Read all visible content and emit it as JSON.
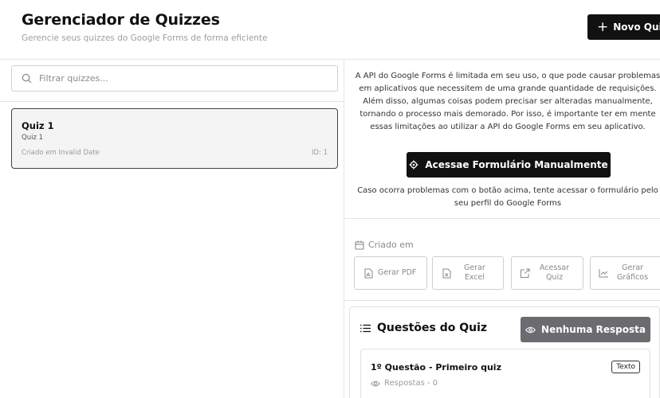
{
  "header": {
    "title": "Gerenciador de Quizzes",
    "subtitle": "Gerencie seus quizzes do Google Forms de forma eficiente",
    "new_button_label": "Novo Quiz"
  },
  "sidebar": {
    "filter_placeholder": "Filtrar quizzes...",
    "quizzes": [
      {
        "title": "Quiz 1",
        "subtitle": "Quiz 1",
        "created": "Criado em Invalid Date",
        "id": "ID: 1"
      }
    ]
  },
  "main": {
    "api_notice": "A API do Google Forms é limitada em seu uso, o que pode causar problemas em aplicativos que necessitem de uma grande quantidade de requisições. Além disso, algumas coisas podem precisar ser alteradas manualmente, tornando o processo mais demorado. Por isso, é importante ter em mente essas limitações ao utilizar a API do Google Forms em seu aplicativo.",
    "access_form_button": "Acessae Formulário Manualmente",
    "problem_notice": "Caso ocorra problemas com o botão acima, tente acessar o formulário pelo seu perfil do Google Forms",
    "created_label": "Criado em",
    "actions": {
      "pdf": "Gerar PDF",
      "excel_1": "Gerar",
      "excel_2": "Excel",
      "quiz_1": "Acessar",
      "quiz_2": "Quiz",
      "charts_1": "Gerar",
      "charts_2": "Gráficos"
    },
    "questions": {
      "title": "Questões do Quiz",
      "no_answer_button": "Nenhuma Resposta",
      "items": [
        {
          "name": "1º Questão - Primeiro quiz",
          "type": "Texto",
          "responses": "Respostas - 0"
        }
      ]
    }
  },
  "colors": {
    "primary": "#111111",
    "muted_button": "#6b6b70",
    "selected_card": "#f4f4f5"
  }
}
